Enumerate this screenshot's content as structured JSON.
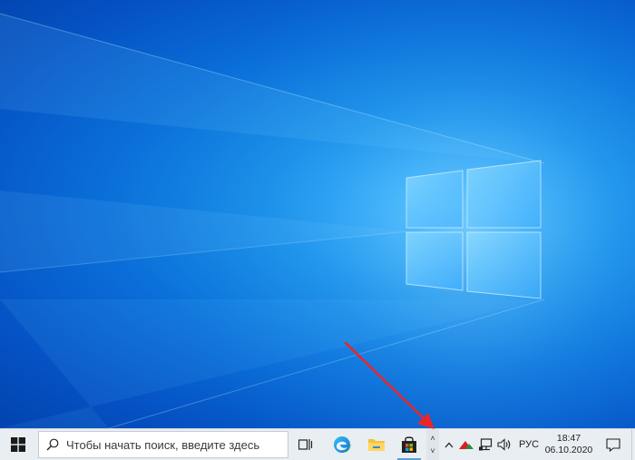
{
  "desktop": {
    "wallpaper": "windows-10-hero",
    "colors": {
      "bg_dark": "#0243ae",
      "bg_light": "#3fb6ff",
      "logo_light": "#bfeaff"
    }
  },
  "taskbar": {
    "search": {
      "placeholder": "Чтобы начать поиск, введите здесь",
      "value": ""
    },
    "pinned": [
      {
        "name": "task-view",
        "icon": "task-view-icon"
      },
      {
        "name": "edge",
        "icon": "edge-icon"
      },
      {
        "name": "file-explorer",
        "icon": "folder-icon"
      },
      {
        "name": "store",
        "icon": "store-bag-icon",
        "active": true
      }
    ],
    "scroll_up": "˄",
    "scroll_down": "˅",
    "tray": {
      "expand_icon": "chevron-up-icon",
      "language": "РУС",
      "time": "18:47",
      "date": "06.10.2020"
    }
  },
  "annotation": {
    "arrow_color": "#e8262b"
  }
}
